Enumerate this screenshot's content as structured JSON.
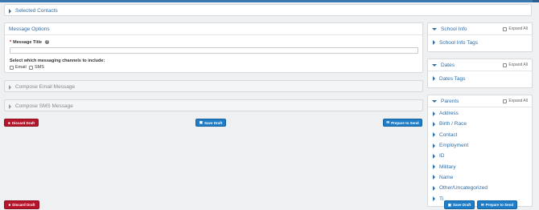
{
  "sections": {
    "selected_contacts": "Selected Contacts",
    "message_options": "Message Options",
    "compose_email": "Compose Email Message",
    "compose_sms": "Compose SMS Message"
  },
  "message_options": {
    "required_marker": "*",
    "title_label": "Message Title",
    "help_glyph": "?",
    "title_value": "",
    "channels_label": "Select which messaging channels to include:",
    "channels": [
      "Email",
      "SMS"
    ]
  },
  "buttons": {
    "discard": "Discard Draft",
    "save": "Save Draft",
    "prepare": "Prepare to Send"
  },
  "sidebar": {
    "expand_all": "Expand All",
    "school_info": {
      "title": "School Info",
      "items": [
        "School Info Tags"
      ]
    },
    "dates": {
      "title": "Dates",
      "items": [
        "Dates Tags"
      ]
    },
    "parents": {
      "title": "Parents",
      "items": [
        "Address",
        "Birth / Race",
        "Contact",
        "Employment",
        "ID",
        "Military",
        "Name",
        "Other/Uncategorized",
        "Ti"
      ]
    }
  },
  "colors": {
    "brand_blue": "#2f6ea7",
    "button_blue": "#1f7dc7",
    "button_red": "#b5142a"
  },
  "icons": {
    "discard": "trash-icon",
    "save": "save-icon",
    "prepare": "send-icon"
  }
}
